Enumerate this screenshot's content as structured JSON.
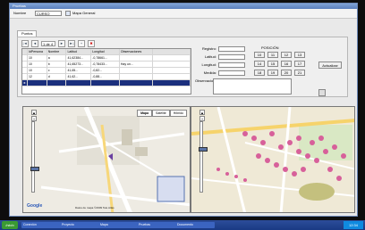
{
  "window": {
    "title": "Pruebas"
  },
  "toolbar": {
    "field_label": "Nombre",
    "field_value": "CURSO",
    "title": "Mapa General"
  },
  "tabs": [
    {
      "label": "Puntos"
    }
  ],
  "navigator": {
    "position": "1 de 4",
    "first": "|◄",
    "prev": "◄",
    "next": "►",
    "last": "►|",
    "add": "+",
    "delete": "✖"
  },
  "grid": {
    "headers": [
      "",
      "IdPersona",
      "Nombre",
      "Latitud",
      "Longitud",
      "Observaciones",
      ""
    ],
    "rows": [
      [
        "",
        "10",
        "a",
        "41,62384...",
        "-0,78661...",
        "",
        ""
      ],
      [
        "",
        "10",
        "b",
        "41,65273...",
        "-0,78433...",
        "Hay un...",
        ""
      ],
      [
        "",
        "10",
        "c",
        "41,65...",
        "-0,82...",
        "",
        ""
      ],
      [
        "",
        "12",
        "d",
        "41,62...",
        "-0,88...",
        "",
        ""
      ],
      [
        "►",
        "",
        "",
        "",
        "",
        "",
        ""
      ]
    ]
  },
  "form": {
    "fields": [
      {
        "label": "Registro:",
        "value": ""
      },
      {
        "label": "Latitud:",
        "value": ""
      },
      {
        "label": "Longitud:",
        "value": ""
      },
      {
        "label": "Medida:",
        "value": ""
      },
      {
        "label": "Observaciones:",
        "value": ""
      }
    ]
  },
  "positions": {
    "label": "POSICIÓN",
    "buttons": [
      "10",
      "11",
      "12",
      "13",
      "14",
      "15",
      "16",
      "17",
      "18",
      "19",
      "20",
      "21"
    ]
  },
  "actions": {
    "button": "Actualizar"
  },
  "map_left": {
    "buttons": [
      "Mapa",
      "Satélite",
      "Híbrido"
    ],
    "logo": "Google",
    "copyright": "Datos de mapa ©2009 Tele Atlas"
  },
  "taskbar": {
    "start": "Inicio",
    "items": [
      "Conexión",
      "Proyecto",
      "Mapa",
      "Pruebas",
      "Documento"
    ],
    "clock": "12:34"
  }
}
